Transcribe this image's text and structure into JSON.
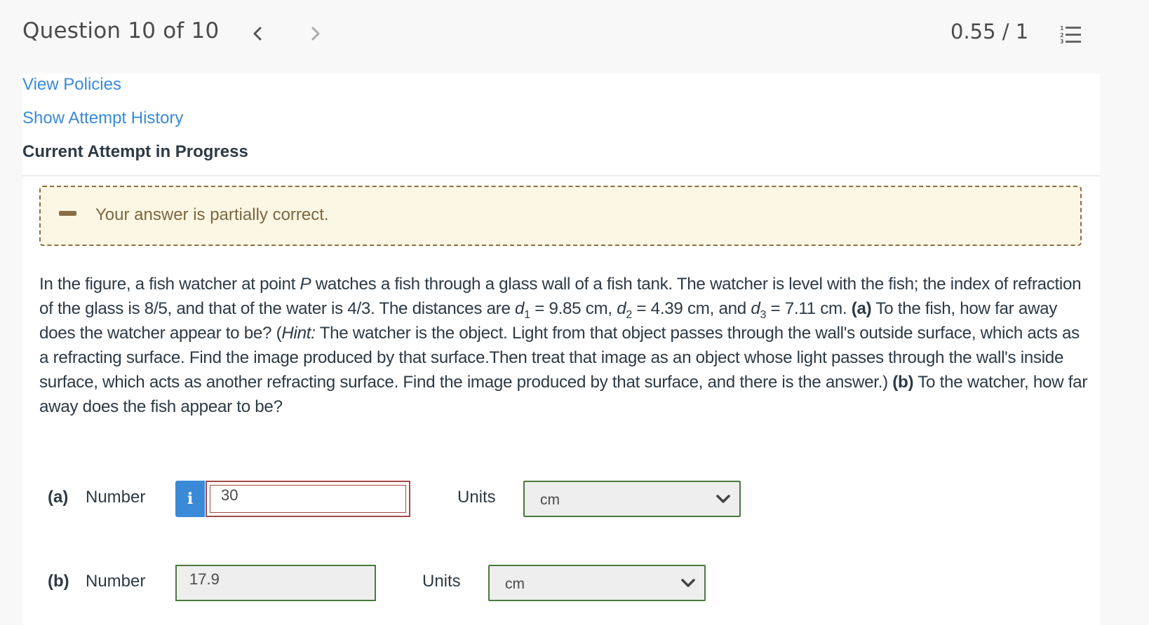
{
  "header": {
    "question_title": "Question 10 of 10",
    "score": "0.55 / 1",
    "prev_icon": "chevron-left-icon",
    "next_icon": "chevron-right-icon",
    "list_icon": "numbered-list-icon"
  },
  "links": {
    "view_policies": "View Policies",
    "show_attempt_history": "Show Attempt History"
  },
  "attempt_heading": "Current Attempt in Progress",
  "feedback": {
    "icon": "partial-credit-icon",
    "text": "Your answer is partially correct.",
    "bg_color": "#fbf7e4",
    "border_color": "#8a6f44"
  },
  "question": {
    "t1": "In the figure, a fish watcher at point ",
    "P": "P",
    "t2": " watches a fish through a glass wall of a fish tank. The watcher is level with the fish; the index of refraction of the glass is 8/5, and that of the water is 4/3. The distances are ",
    "d": "d",
    "sub1": "1",
    "t3": " = 9.85 cm, ",
    "sub2": "2",
    "t4": " = 4.39 cm, and ",
    "sub3": "3",
    "t5": " = 7.11 cm. ",
    "a_label": "(a)",
    "t6": " To the fish, how far away does the watcher appear to be? (",
    "hint": "Hint:",
    "t7": " The watcher is the object. Light from that object passes through the wall's outside surface, which acts as a refracting surface. Find the image produced by that surface.Then treat that image as an object whose light passes through the wall's inside surface, which acts as another refracting surface. Find the image produced by that surface, and there is the answer.) ",
    "b_label": "(b)",
    "t8": " To the watcher, how far away does the fish appear to be?"
  },
  "answers": [
    {
      "part": "(a)",
      "number_label": "Number",
      "info_icon": "info-icon",
      "info_glyph": "i",
      "value": "30",
      "status": "incorrect",
      "units_label": "Units",
      "unit": "cm",
      "unit_status": "correct"
    },
    {
      "part": "(b)",
      "number_label": "Number",
      "value": "17.9",
      "status": "correct",
      "units_label": "Units",
      "unit": "cm",
      "unit_status": "correct"
    }
  ],
  "colors": {
    "link": "#3a8ad8",
    "incorrect": "#a14a4a",
    "correct": "#4a7a3e",
    "info": "#3a8ad8"
  }
}
